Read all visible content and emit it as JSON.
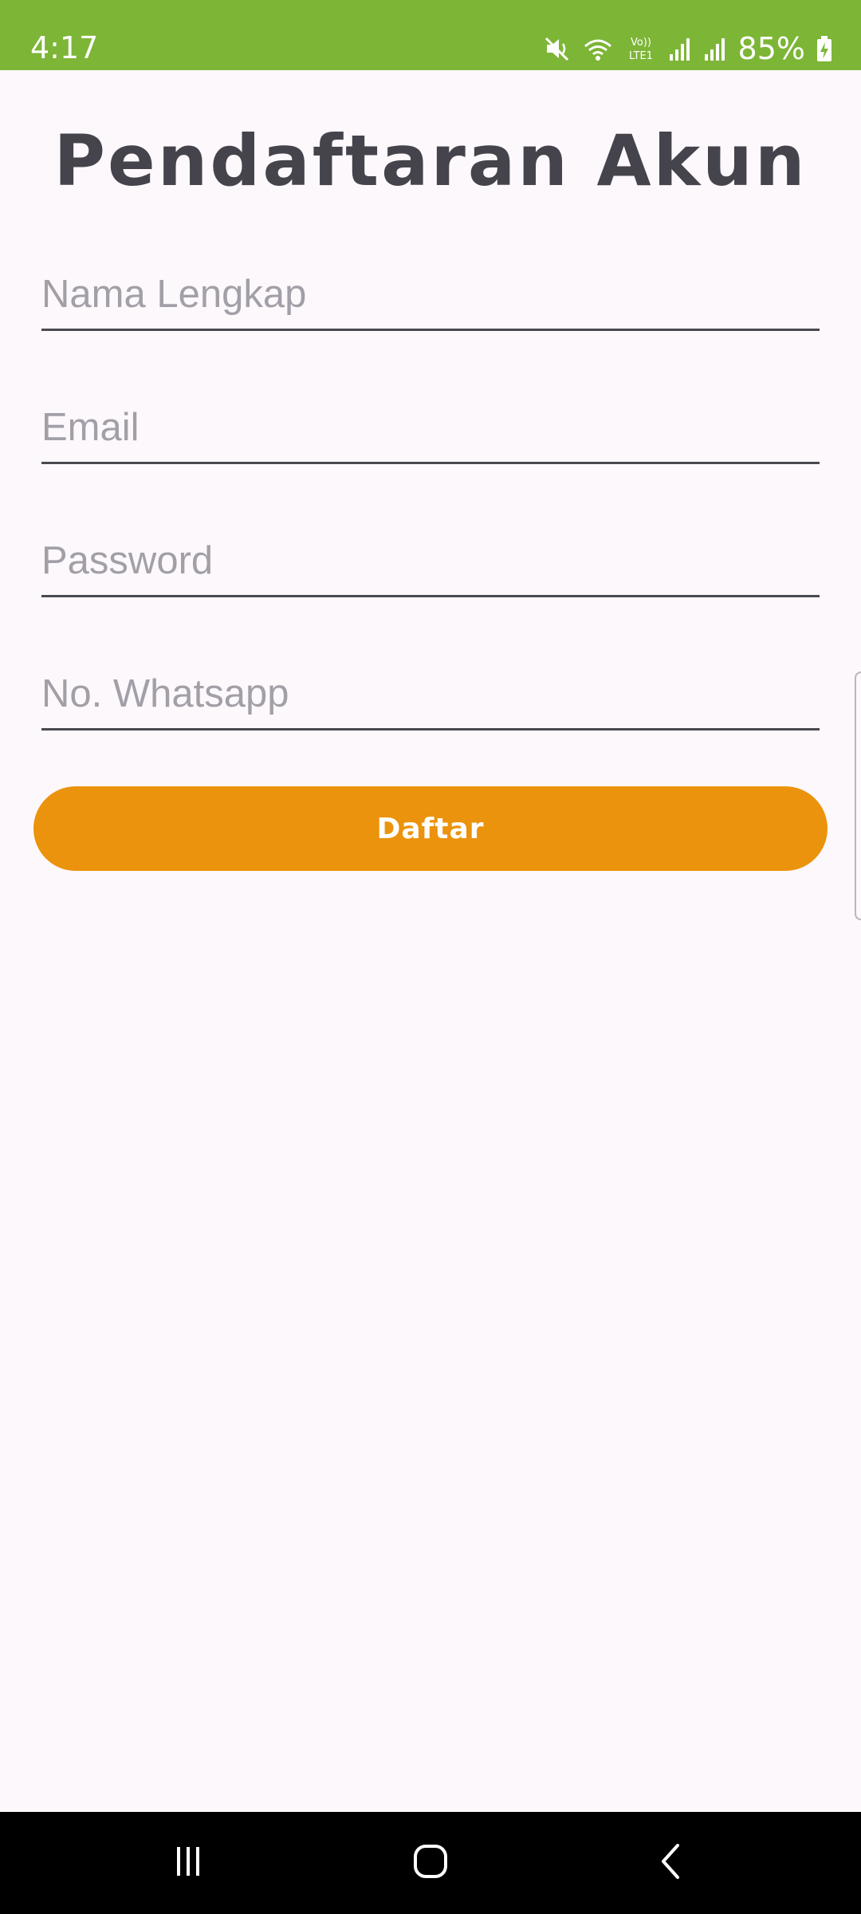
{
  "status_bar": {
    "time": "4:17",
    "battery_percent": "85%",
    "icons": [
      "mute-icon",
      "wifi-icon",
      "volte-icon",
      "signal-icon",
      "signal-icon",
      "battery-charging-icon"
    ],
    "background_color": "#7db536"
  },
  "page": {
    "title": "Pendaftaran Akun"
  },
  "form": {
    "full_name": {
      "placeholder": "Nama Lengkap",
      "value": ""
    },
    "email": {
      "placeholder": "Email",
      "value": ""
    },
    "password": {
      "placeholder": "Password",
      "value": ""
    },
    "whatsapp": {
      "placeholder": "No. Whatsapp",
      "value": ""
    },
    "submit_label": "Daftar",
    "submit_color": "#eb930c"
  },
  "nav_bar": {
    "buttons": [
      "recent-apps-icon",
      "home-icon",
      "back-icon"
    ]
  }
}
